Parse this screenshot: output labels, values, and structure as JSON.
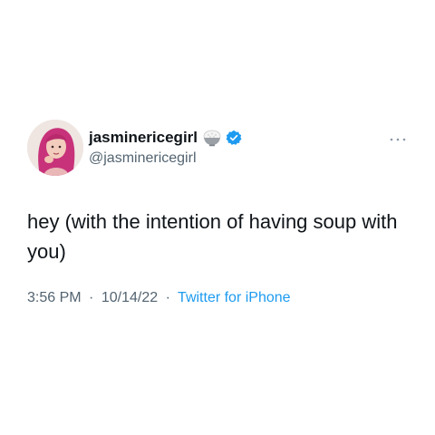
{
  "author": {
    "display_name": "jasminericegirl",
    "handle": "@jasminericegirl",
    "name_emoji_icon": "rice-bowl-icon",
    "verified_icon": "verified-badge-icon",
    "verified_color": "#1d9bf0"
  },
  "tweet": {
    "text": "hey (with the intention of having soup with you)"
  },
  "meta": {
    "time": "3:56 PM",
    "separator": "·",
    "date": "10/14/22",
    "source": "Twitter for iPhone"
  },
  "colors": {
    "text_primary": "#0f1419",
    "text_secondary": "#536471",
    "link": "#1d9bf0",
    "avatar_hair": "#c8327a"
  },
  "icons": {
    "more": "more-horizontal-icon"
  }
}
